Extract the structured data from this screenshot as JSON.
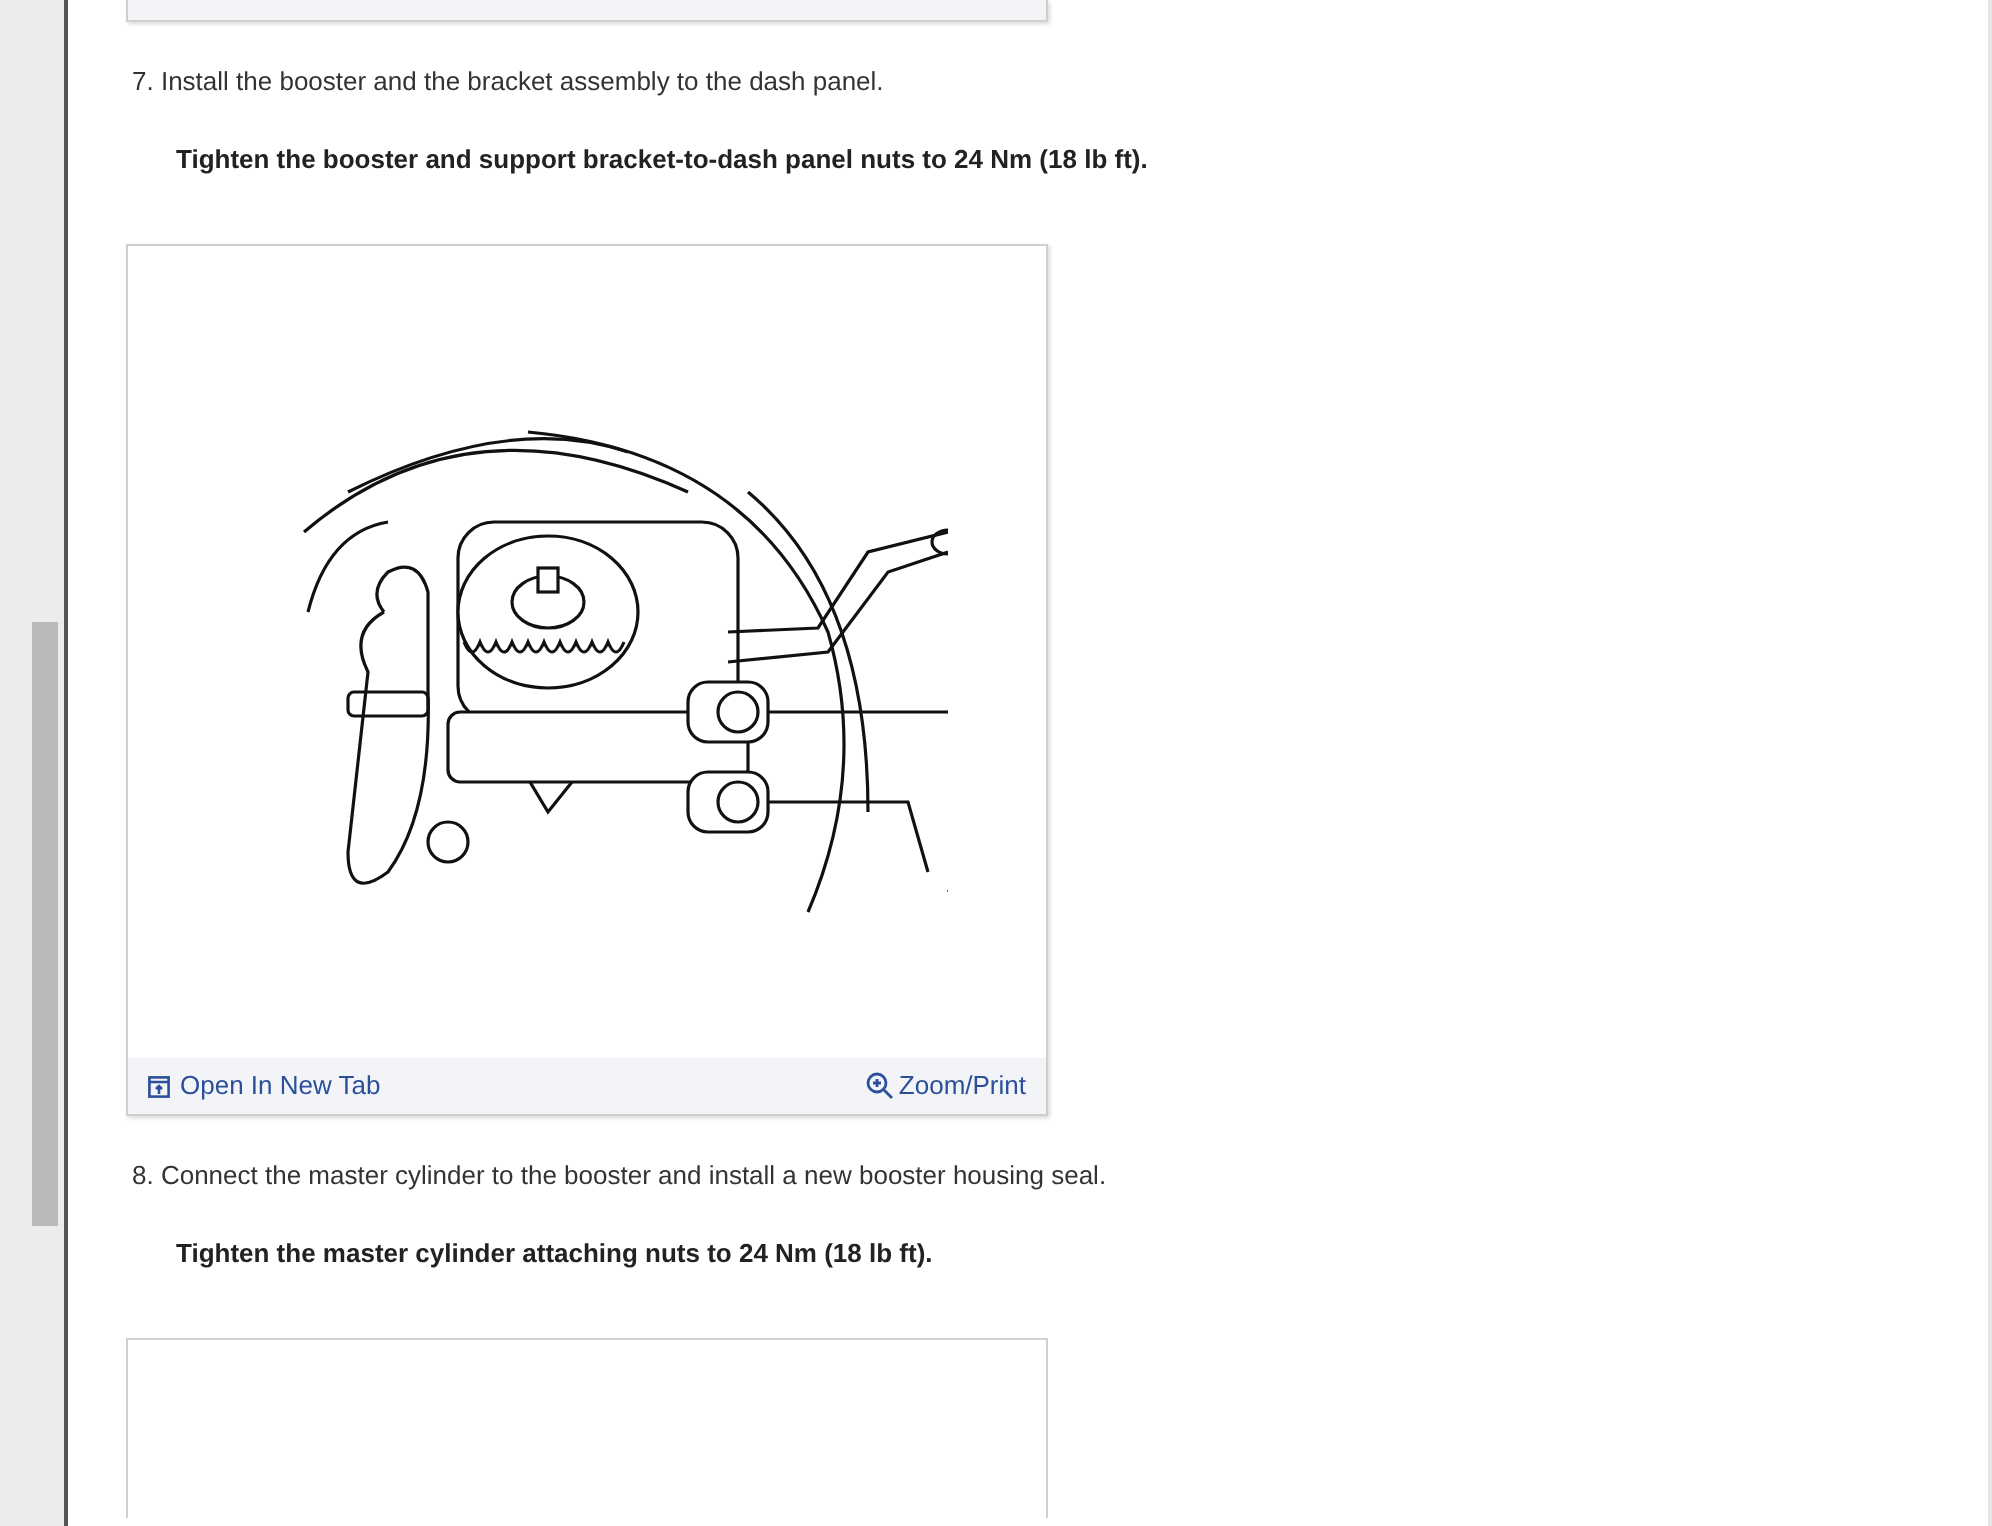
{
  "steps": [
    {
      "text": "7. Install the booster and the bracket assembly to the dash panel.",
      "spec": "Tighten the booster and support bracket-to-dash panel nuts to 24 Nm (18 lb ft).",
      "figure": {
        "kind": "illustration",
        "open_link": "Open In New Tab",
        "zoom_link": "Zoom/Print"
      }
    },
    {
      "text": "8. Connect the master cylinder to the booster and install a new booster housing seal.",
      "spec": "Tighten the master cylinder attaching nuts to 24 Nm (18 lb ft).",
      "figure": {
        "kind": "blank"
      }
    }
  ]
}
